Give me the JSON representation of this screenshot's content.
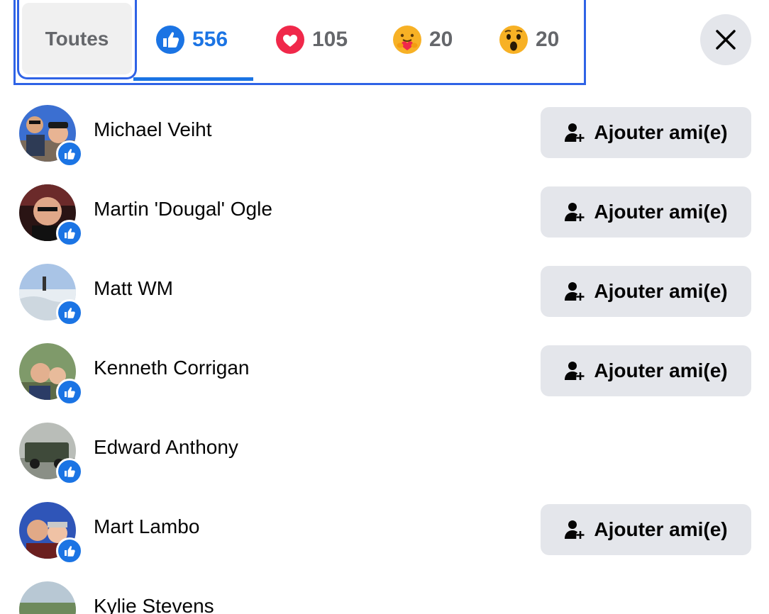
{
  "tabs": {
    "all_label": "Toutes",
    "like_count": "556",
    "love_count": "105",
    "care_count": "20",
    "wow_count": "20"
  },
  "close_icon": "close-icon",
  "add_friend_label": "Ajouter ami(e)",
  "people": [
    {
      "name": "Michael Veiht",
      "has_add_button": true
    },
    {
      "name": "Martin 'Dougal' Ogle",
      "has_add_button": true
    },
    {
      "name": "Matt WM",
      "has_add_button": true
    },
    {
      "name": "Kenneth Corrigan",
      "has_add_button": true
    },
    {
      "name": "Edward Anthony",
      "has_add_button": false
    },
    {
      "name": "Mart Lambo",
      "has_add_button": true
    },
    {
      "name": "Kylie Stevens",
      "has_add_button": false
    }
  ],
  "colors": {
    "accent": "#1b74e4",
    "focus_outline": "#2f63e6",
    "button_bg": "#e4e6eb",
    "secondary_text": "#65676b"
  }
}
